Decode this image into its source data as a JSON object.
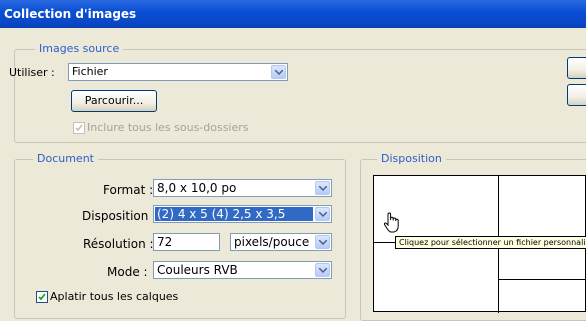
{
  "window": {
    "title": "Collection d'images"
  },
  "source": {
    "legend": "Images source",
    "use_label": "Utiliser :",
    "use_value": "Fichier",
    "browse_label": "Parcourir...",
    "include_subfolders_label": "Inclure tous les sous-dossiers"
  },
  "document": {
    "legend": "Document",
    "format_label": "Format :",
    "format_value": "8,0 x 10,0 po",
    "layout_label": "Disposition :",
    "layout_value": "(2) 4 x 5 (4) 2,5 x 3,5",
    "resolution_label": "Résolution :",
    "resolution_value": "72",
    "resolution_unit": "pixels/pouce",
    "mode_label": "Mode :",
    "mode_value": "Couleurs RVB",
    "flatten_label": "Aplatir tous les calques"
  },
  "preview": {
    "legend": "Disposition",
    "tooltip": "Cliquez pour sélectionner un fichier personnalisé."
  },
  "colors": {
    "accent": "#2c5ec9",
    "selection": "#316ac5",
    "titlebar": "#0a4fd6"
  }
}
